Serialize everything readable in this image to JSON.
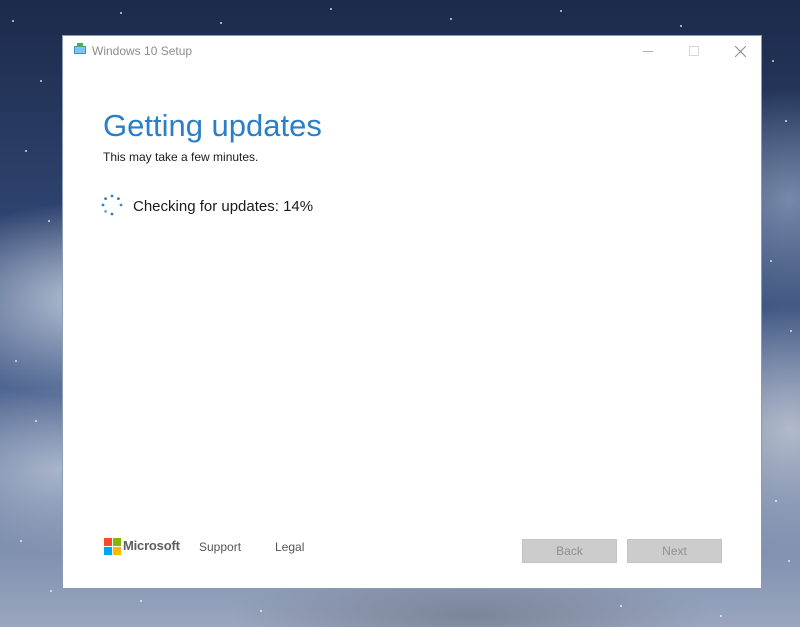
{
  "window": {
    "title": "Windows 10 Setup"
  },
  "main": {
    "heading": "Getting updates",
    "subheading": "This may take a few minutes.",
    "status": "Checking for updates: 14%",
    "progress_percent": 14
  },
  "footer": {
    "brand": "Microsoft",
    "links": [
      "Support",
      "Legal"
    ],
    "back_label": "Back",
    "next_label": "Next"
  },
  "icons": {
    "app": "setup-icon",
    "spinner": "loading-spinner-icon",
    "minimize": "minimize-icon",
    "maximize": "maximize-icon",
    "close": "close-icon",
    "brand_logo": "microsoft-logo-icon"
  },
  "colors": {
    "accent": "#2b7fc6",
    "logo_red": "#f25022",
    "logo_green": "#7fba00",
    "logo_blue": "#00a4ef",
    "logo_yellow": "#ffb900",
    "disabled_button": "#cccccc"
  }
}
